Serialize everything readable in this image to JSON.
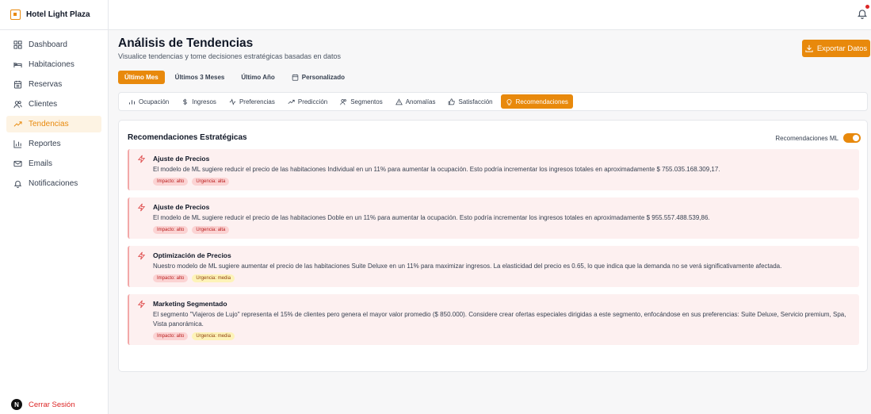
{
  "brand": {
    "name": "Hotel Light Plaza"
  },
  "sidebar": {
    "items": [
      {
        "label": "Dashboard",
        "icon": "grid-icon"
      },
      {
        "label": "Habitaciones",
        "icon": "bed-icon"
      },
      {
        "label": "Reservas",
        "icon": "calendar-icon"
      },
      {
        "label": "Clientes",
        "icon": "users-icon"
      },
      {
        "label": "Tendencias",
        "icon": "trend-icon",
        "active": true
      },
      {
        "label": "Reportes",
        "icon": "bar-chart-icon"
      },
      {
        "label": "Emails",
        "icon": "mail-icon"
      },
      {
        "label": "Notificaciones",
        "icon": "bell-icon"
      }
    ],
    "logout_label": "Cerrar Sesión",
    "avatar_letter": "N"
  },
  "header": {
    "title": "Análisis de Tendencias",
    "subtitle": "Visualice tendencias y tome decisiones estratégicas basadas en datos",
    "export_label": "Exportar Datos"
  },
  "period_tabs": [
    {
      "label": "Último Mes",
      "active": true
    },
    {
      "label": "Últimos 3 Meses"
    },
    {
      "label": "Último Año"
    },
    {
      "label": "Personalizado",
      "icon": "calendar-icon"
    }
  ],
  "analysis_tabs": [
    {
      "label": "Ocupación",
      "icon": "bar-chart-icon"
    },
    {
      "label": "Ingresos",
      "icon": "dollar-icon"
    },
    {
      "label": "Preferencias",
      "icon": "activity-icon"
    },
    {
      "label": "Predicción",
      "icon": "trend-icon"
    },
    {
      "label": "Segmentos",
      "icon": "users-icon"
    },
    {
      "label": "Anomalías",
      "icon": "alert-icon"
    },
    {
      "label": "Satisfacción",
      "icon": "thumbs-up-icon"
    },
    {
      "label": "Recomendaciones",
      "icon": "lightbulb-icon",
      "active": true
    }
  ],
  "recommendations_card": {
    "title": "Recomendaciones Estratégicas",
    "toggle_label": "Recomendaciones ML",
    "items": [
      {
        "title": "Ajuste de Precios",
        "text": "El modelo de ML sugiere reducir el precio de las habitaciones Individual en un 11% para aumentar la ocupación. Esto podría incrementar los ingresos totales en aproximadamente $ 755.035.168.309,17.",
        "impact": "Impacto: alto",
        "urgency": "Urgencia: alta",
        "urgency_level": "high"
      },
      {
        "title": "Ajuste de Precios",
        "text": "El modelo de ML sugiere reducir el precio de las habitaciones Doble en un 11% para aumentar la ocupación. Esto podría incrementar los ingresos totales en aproximadamente $ 955.557.488.539,86.",
        "impact": "Impacto: alto",
        "urgency": "Urgencia: alta",
        "urgency_level": "high"
      },
      {
        "title": "Optimización de Precios",
        "text": "Nuestro modelo de ML sugiere aumentar el precio de las habitaciones Suite Deluxe en un 11% para maximizar ingresos. La elasticidad del precio es 0.65, lo que indica que la demanda no se verá significativamente afectada.",
        "impact": "Impacto: alto",
        "urgency": "Urgencia: media",
        "urgency_level": "medium"
      },
      {
        "title": "Marketing Segmentado",
        "text": "El segmento \"Viajeros de Lujo\" representa el 15% de clientes pero genera el mayor valor promedio ($ 850.000). Considere crear ofertas especiales dirigidas a este segmento, enfocándose en sus preferencias: Suite Deluxe, Servicio premium, Spa, Vista panorámica.",
        "impact": "Impacto: alto",
        "urgency": "Urgencia: media",
        "urgency_level": "medium"
      }
    ]
  },
  "colors": {
    "accent": "#e8890c",
    "danger": "#dc2626",
    "rec_bg": "#fdf0f0"
  }
}
